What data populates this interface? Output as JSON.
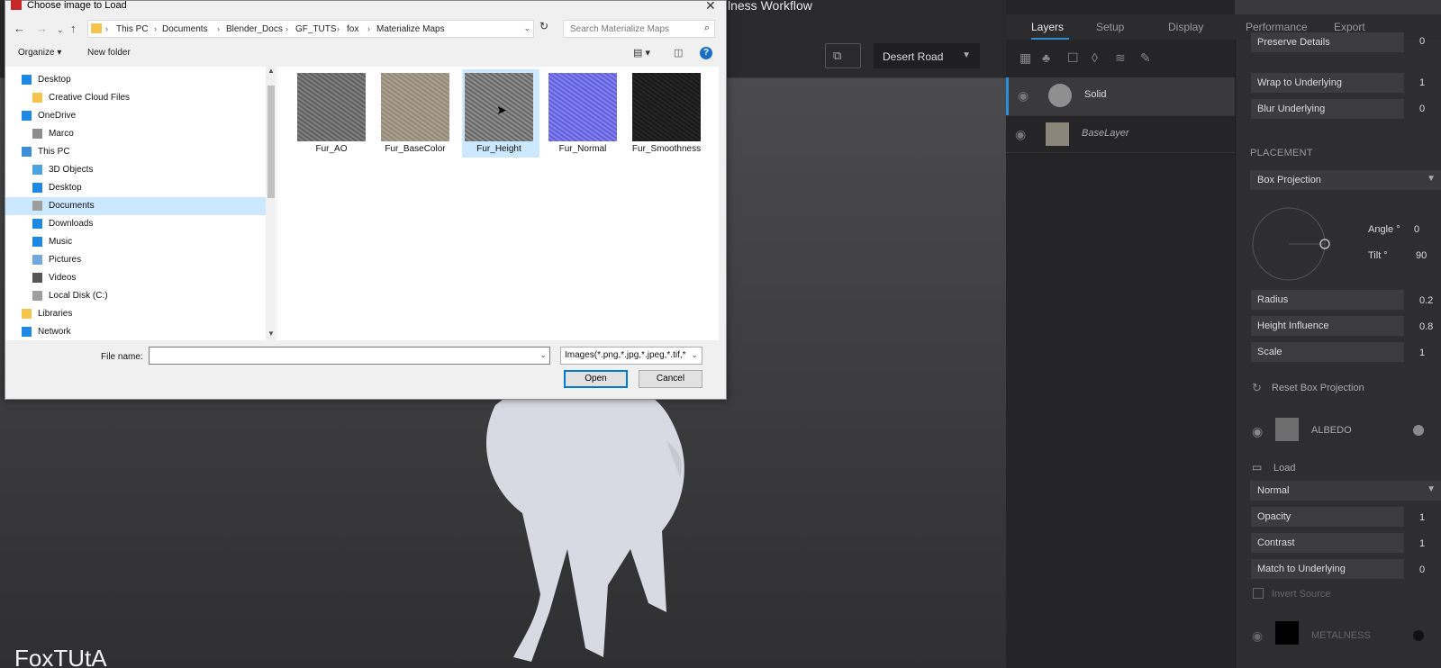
{
  "app": {
    "title": "lness Workflow",
    "env_select": "Desert Road",
    "watermark": "FoxTUtA"
  },
  "tabs": [
    "Layers",
    "Setup",
    "Display",
    "Performance",
    "Export"
  ],
  "layers": [
    {
      "name": "Solid",
      "color": "#8f8f8f"
    },
    {
      "name": "BaseLayer",
      "color": "#8c857c"
    }
  ],
  "props": {
    "preserve_details": {
      "label": "Preserve Details",
      "value": "0"
    },
    "wrap": {
      "label": "Wrap to Underlying",
      "value": "1"
    },
    "blur": {
      "label": "Blur Underlying",
      "value": "0"
    },
    "placement_header": "PLACEMENT",
    "placement_mode": "Box Projection",
    "angle": {
      "label": "Angle °",
      "value": "0"
    },
    "tilt": {
      "label": "Tilt °",
      "value": "90"
    },
    "radius": {
      "label": "Radius",
      "value": "0.2"
    },
    "height_influence": {
      "label": "Height Influence",
      "value": "0.8"
    },
    "scale": {
      "label": "Scale",
      "value": "1"
    },
    "reset": "Reset Box Projection",
    "albedo": "ALBEDO",
    "load": "Load",
    "blend_mode": "Normal",
    "opacity": {
      "label": "Opacity",
      "value": "1"
    },
    "contrast": {
      "label": "Contrast",
      "value": "1"
    },
    "match": {
      "label": "Match to Underlying",
      "value": "0"
    },
    "invert": "Invert Source",
    "metalness": "METALNESS"
  },
  "dialog": {
    "title": "Choose image to Load",
    "breadcrumbs": [
      "This PC",
      "Documents",
      "Blender_Docs",
      "GF_TUTS",
      "fox",
      "Materialize Maps"
    ],
    "search_placeholder": "Search Materialize Maps",
    "organize": "Organize ▾",
    "new_folder": "New folder",
    "nav_items": [
      {
        "label": "Desktop",
        "color": "#1e88e5"
      },
      {
        "label": "Creative Cloud Files",
        "color": "#f4c44d"
      },
      {
        "label": "OneDrive",
        "color": "#1e88e5"
      },
      {
        "label": "Marco",
        "color": "#8d8d8d"
      },
      {
        "label": "This PC",
        "color": "#3b8fd6"
      },
      {
        "label": "3D Objects",
        "color": "#4aa3df"
      },
      {
        "label": "Desktop",
        "color": "#1e88e5"
      },
      {
        "label": "Documents",
        "color": "#9e9e9e"
      },
      {
        "label": "Downloads",
        "color": "#1e88e5"
      },
      {
        "label": "Music",
        "color": "#1e88e5"
      },
      {
        "label": "Pictures",
        "color": "#6fa8dc"
      },
      {
        "label": "Videos",
        "color": "#555555"
      },
      {
        "label": "Local Disk (C:)",
        "color": "#9e9e9e"
      },
      {
        "label": "Libraries",
        "color": "#f4c44d"
      },
      {
        "label": "Network",
        "color": "#1e88e5"
      }
    ],
    "files": [
      {
        "name": "Fur_AO",
        "colors": [
          "#8a8a8a",
          "#555555"
        ]
      },
      {
        "name": "Fur_BaseColor",
        "colors": [
          "#b3a896",
          "#8c8271"
        ]
      },
      {
        "name": "Fur_Height",
        "colors": [
          "#9a9a9a",
          "#5b5b5b"
        ]
      },
      {
        "name": "Fur_Normal",
        "colors": [
          "#8a8ef2",
          "#5a52d8"
        ]
      },
      {
        "name": "Fur_Smoothness",
        "colors": [
          "#2a2a2a",
          "#141414"
        ]
      }
    ],
    "file_name_label": "File name:",
    "file_name_value": "",
    "file_type": "Images(*.png,*.jpg,*.jpeg,*.tif,*",
    "open": "Open",
    "cancel": "Cancel"
  }
}
